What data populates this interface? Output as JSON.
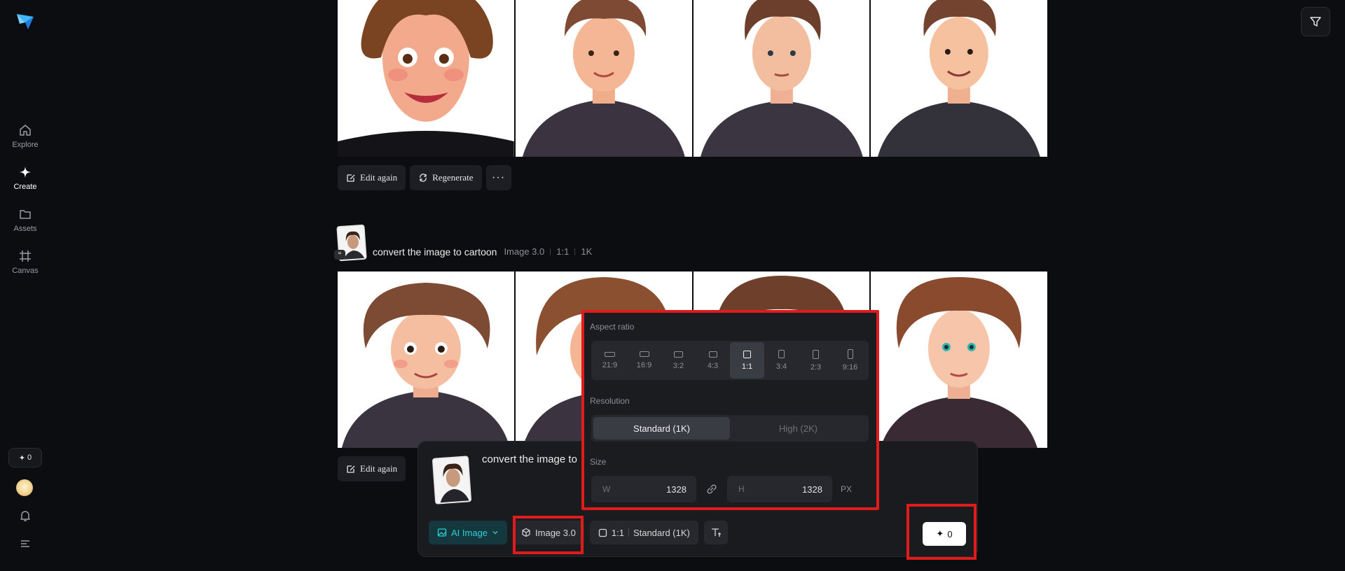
{
  "sidebar": {
    "items": [
      {
        "label": "Explore",
        "icon": "home-icon"
      },
      {
        "label": "Create",
        "icon": "sparkle-icon"
      },
      {
        "label": "Assets",
        "icon": "folder-icon"
      },
      {
        "label": "Canvas",
        "icon": "canvas-icon"
      }
    ],
    "credits": "0"
  },
  "gallery": {
    "top_actions": {
      "edit": "Edit again",
      "regenerate": "Regenerate",
      "more": "···"
    },
    "prompt": {
      "text": "convert the image to cartoon",
      "model": "Image 3.0",
      "ratio": "1:1",
      "resolution": "1K"
    },
    "bottom_actions": {
      "edit": "Edit again"
    }
  },
  "composer": {
    "prompt_text": "convert the image to",
    "mode": "AI Image",
    "model": "Image 3.0",
    "ratio": "1:1",
    "resolution": "Standard (1K)",
    "generate_count": "0"
  },
  "popover": {
    "aspect_label": "Aspect ratio",
    "ratios": [
      "21:9",
      "16:9",
      "3:2",
      "4:3",
      "1:1",
      "3:4",
      "2:3",
      "9:16"
    ],
    "selected_ratio": "1:1",
    "resolution_label": "Resolution",
    "resolutions": [
      "Standard (1K)",
      "High (2K)"
    ],
    "size_label": "Size",
    "width_key": "W",
    "width": "1328",
    "height_key": "H",
    "height": "1328",
    "unit": "PX"
  },
  "colors": {
    "accent": "#2fd0d6",
    "highlight": "#e11b1b",
    "background": "#0c0d10"
  }
}
